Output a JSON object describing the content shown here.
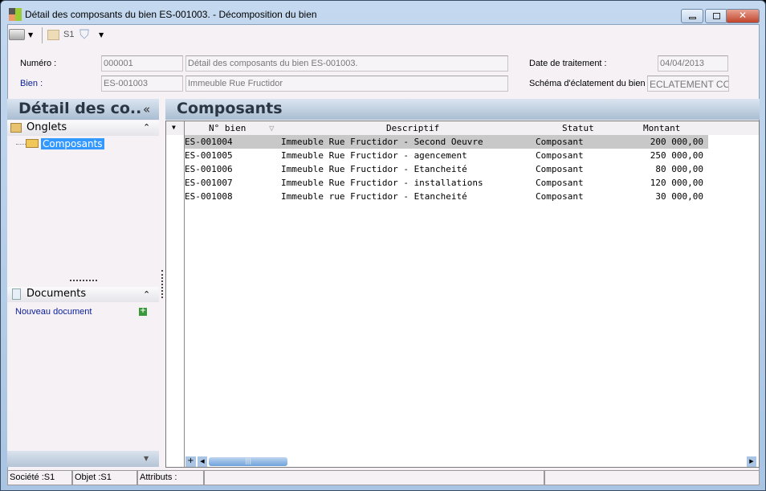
{
  "window": {
    "title": "Détail des composants du bien ES-001003. -  Décomposition du bien"
  },
  "toolbar": {
    "company": "S1"
  },
  "form": {
    "numero_label": "Numéro :",
    "numero_value": "000001",
    "numero_desc": "Détail des composants du bien ES-001003.",
    "bien_label": "Bien :",
    "bien_value": "ES-001003",
    "bien_desc": "Immeuble Rue Fructidor",
    "date_label": "Date de traitement :",
    "date_value": "04/04/2013",
    "schema_label": "Schéma d'éclatement du bien :",
    "schema_value": "ECLATEMENT COM"
  },
  "left_panel": {
    "title": "Détail des co..",
    "collapse": "«",
    "onglets_label": "Onglets",
    "onglets_item": "Composants",
    "documents_label": "Documents",
    "new_document": "Nouveau document"
  },
  "grid": {
    "title": "Composants",
    "columns": [
      "N° bien",
      "Descriptif",
      "Statut",
      "Montant"
    ],
    "rows": [
      [
        "ES-001004",
        "Immeuble Rue Fructidor - Second Oeuvre",
        "Composant",
        "200 000,00"
      ],
      [
        "ES-001005",
        "Immeuble Rue Fructidor - agencement",
        "Composant",
        "250 000,00"
      ],
      [
        "ES-001006",
        "Immeuble Rue Fructidor - Etancheité",
        "Composant",
        "80 000,00"
      ],
      [
        "ES-001007",
        "Immeuble Rue Fructidor - installations",
        "Composant",
        "120 000,00"
      ],
      [
        "ES-001008",
        "Immeuble rue Fructidor - Etancheité",
        "Composant",
        "30 000,00"
      ]
    ],
    "selected_row": 0
  },
  "status_bar": {
    "societe": "Société :S1",
    "objet": "Objet :S1",
    "attributs": "Attributs :"
  },
  "colors": {
    "link": "#0a1e9a",
    "selection": "#3399ff",
    "selected_row": "#c8c8c8"
  }
}
